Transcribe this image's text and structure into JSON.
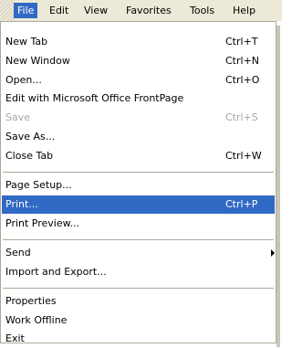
{
  "menubar": {
    "items": [
      {
        "label": "File",
        "active": true
      },
      {
        "label": "Edit"
      },
      {
        "label": "View"
      },
      {
        "label": "Favorites"
      },
      {
        "label": "Tools"
      },
      {
        "label": "Help"
      }
    ]
  },
  "file_menu": {
    "new_tab": {
      "label": "New Tab",
      "shortcut": "Ctrl+T"
    },
    "new_window": {
      "label": "New Window",
      "shortcut": "Ctrl+N"
    },
    "open": {
      "label": "Open...",
      "shortcut": "Ctrl+O"
    },
    "edit_frontpage": {
      "label": "Edit with Microsoft Office FrontPage"
    },
    "save": {
      "label": "Save",
      "shortcut": "Ctrl+S",
      "disabled": true
    },
    "save_as": {
      "label": "Save As..."
    },
    "close_tab": {
      "label": "Close Tab",
      "shortcut": "Ctrl+W"
    },
    "page_setup": {
      "label": "Page Setup..."
    },
    "print": {
      "label": "Print...",
      "shortcut": "Ctrl+P",
      "highlighted": true
    },
    "print_preview": {
      "label": "Print Preview..."
    },
    "send": {
      "label": "Send",
      "has_submenu": true
    },
    "import_export": {
      "label": "Import and Export..."
    },
    "properties": {
      "label": "Properties"
    },
    "work_offline": {
      "label": "Work Offline"
    },
    "exit": {
      "label": "Exit"
    }
  },
  "colors": {
    "highlight": "#316ac5",
    "menubar_bg": "#ece9d8",
    "disabled_text": "#a7a6aa",
    "separator": "#aca899"
  }
}
